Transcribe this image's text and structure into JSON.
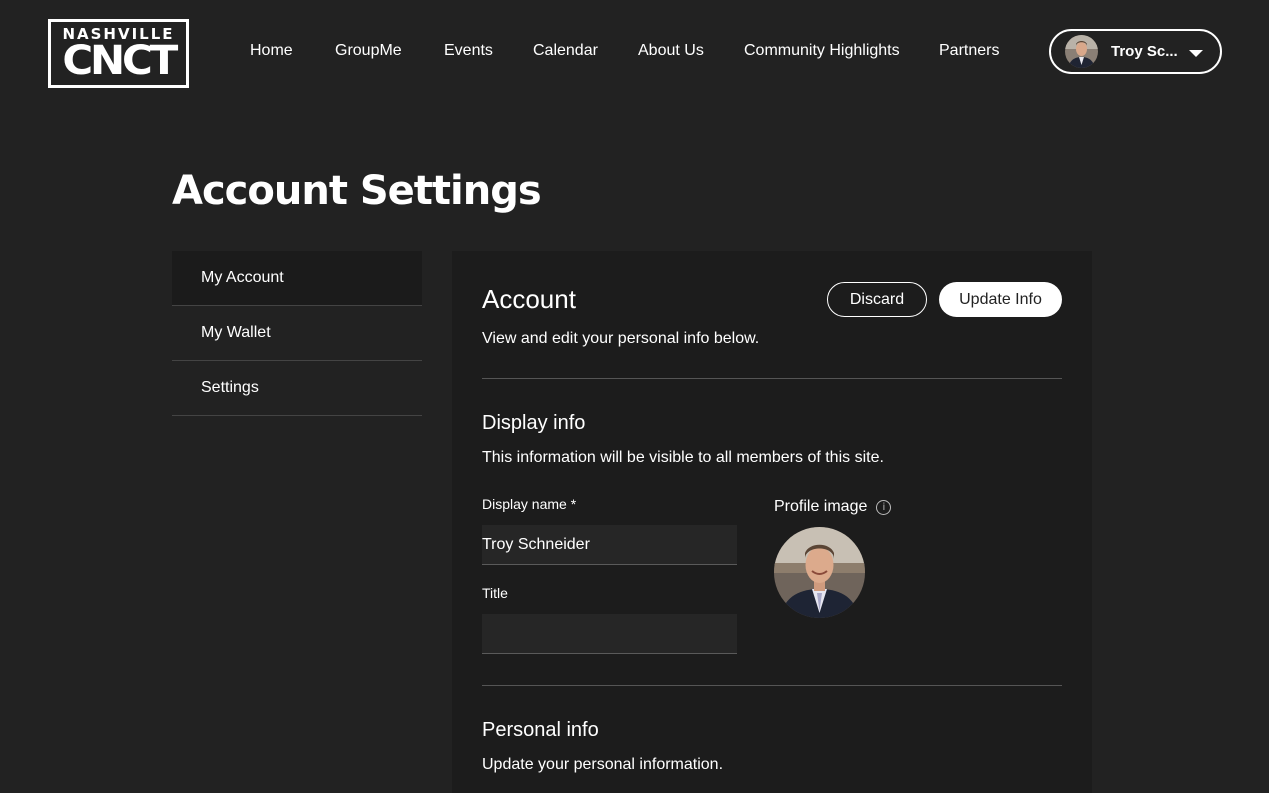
{
  "header": {
    "logo_top": "NASHVILLE",
    "logo_main": "CNCT",
    "nav": [
      {
        "label": "Home"
      },
      {
        "label": "GroupMe"
      },
      {
        "label": "Events"
      },
      {
        "label": "Calendar"
      },
      {
        "label": "About Us"
      },
      {
        "label": "Community Highlights"
      },
      {
        "label": "Partners"
      }
    ],
    "user": {
      "name": "Troy Sc...",
      "avatar_icon": "user-avatar-icon",
      "menu_icon": "caret-down-icon"
    }
  },
  "page_title": "Account Settings",
  "sidebar": {
    "items": [
      {
        "label": "My Account",
        "active": true
      },
      {
        "label": "My Wallet",
        "active": false
      },
      {
        "label": "Settings",
        "active": false
      }
    ]
  },
  "account": {
    "title": "Account",
    "subtitle": "View and edit your personal info below.",
    "discard_label": "Discard",
    "update_label": "Update Info",
    "display_info": {
      "title": "Display info",
      "subtitle": "This information will be visible to all members of this site.",
      "display_name_label": "Display name *",
      "display_name_value": "Troy Schneider",
      "title_label": "Title",
      "title_value": "",
      "profile_image_label": "Profile image",
      "info_icon": "info-icon"
    },
    "personal_info": {
      "title": "Personal info",
      "subtitle": "Update your personal information."
    }
  },
  "colors": {
    "background": "#222222",
    "card": "#1c1c1c",
    "text": "#ffffff",
    "divider": "#555555"
  }
}
